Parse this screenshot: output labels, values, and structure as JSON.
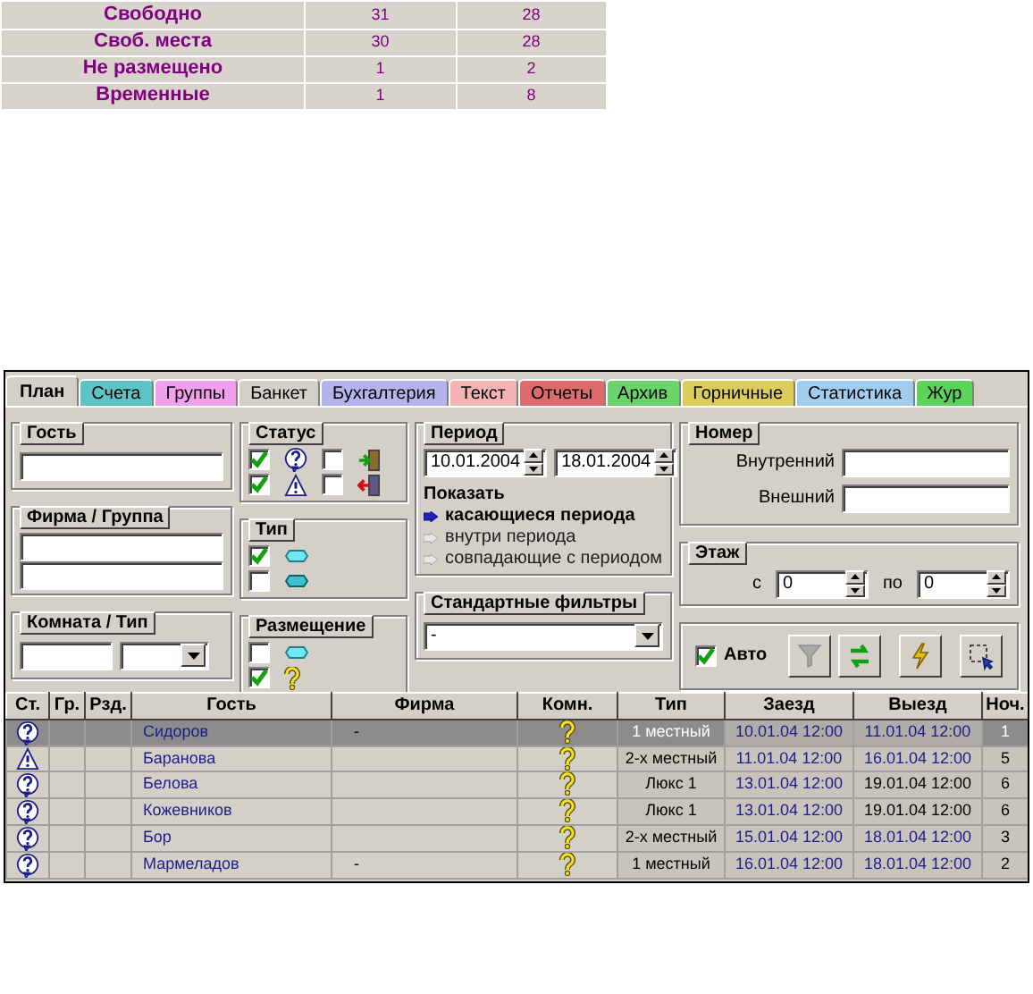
{
  "summary_table": {
    "rows": [
      {
        "label": "Свободно",
        "column_2": "31",
        "column_3": "28"
      },
      {
        "label": "Своб. места",
        "column_2": "30",
        "column_3": "28"
      },
      {
        "label": "Не размещено",
        "column_2": "1",
        "column_3": "2"
      },
      {
        "label": "Временные",
        "column_2": "1",
        "column_3": "8"
      }
    ]
  },
  "tabs": [
    {
      "label": "План",
      "color": "#d4d0c8",
      "selected": true
    },
    {
      "label": "Счета",
      "color": "#5cc4c4",
      "selected": false
    },
    {
      "label": "Группы",
      "color": "#f0a0ec",
      "selected": false
    },
    {
      "label": "Банкет",
      "color": "#d4d0c8",
      "selected": false
    },
    {
      "label": "Бухгалтерия",
      "color": "#b4b4ec",
      "selected": false
    },
    {
      "label": "Текст",
      "color": "#f4b4b4",
      "selected": false
    },
    {
      "label": "Отчеты",
      "color": "#dc6c6c",
      "selected": false
    },
    {
      "label": "Архив",
      "color": "#6cd46c",
      "selected": false
    },
    {
      "label": "Горничные",
      "color": "#dccc5c",
      "selected": false
    },
    {
      "label": "Статистика",
      "color": "#a0ccf0",
      "selected": false
    },
    {
      "label": "Жур",
      "color": "#5cd45c",
      "selected": false
    }
  ],
  "guest": {
    "title": "Гость"
  },
  "firm_group": {
    "title": "Фирма / Группа"
  },
  "room_type": {
    "title": "Комната / Тип"
  },
  "status": {
    "title": "Статус",
    "items": [
      {
        "kind": "question",
        "checked": true
      },
      {
        "kind": "door-in",
        "checked": false
      },
      {
        "kind": "warning",
        "checked": true
      },
      {
        "kind": "door-out",
        "checked": false
      }
    ]
  },
  "type": {
    "title": "Тип",
    "items": [
      {
        "kind": "bed",
        "checked": true
      },
      {
        "kind": "bed-dark",
        "checked": false
      }
    ]
  },
  "placement": {
    "title": "Размещение",
    "items": [
      {
        "kind": "bed",
        "checked": false
      },
      {
        "kind": "yellow-question",
        "checked": true
      }
    ]
  },
  "period": {
    "title": "Период",
    "from": "10.01.2004",
    "to": "18.01.2004",
    "show_label": "Показать",
    "options": [
      {
        "label": "касающиеся периода",
        "selected": true
      },
      {
        "label": "внутри периода",
        "selected": false
      },
      {
        "label": "совпадающие с периодом",
        "selected": false
      }
    ]
  },
  "number": {
    "title": "Номер",
    "fields": [
      {
        "label": "Внутренний"
      },
      {
        "label": "Внешний"
      }
    ]
  },
  "floor": {
    "title": "Этаж",
    "from_label": "с",
    "from": "0",
    "to_label": "по",
    "to": "0"
  },
  "standard_filters": {
    "title": "Стандартные фильтры",
    "value": "-"
  },
  "toolbar": {
    "auto_label": "Авто",
    "auto_checked": true,
    "buttons": [
      {
        "kind": "filter",
        "disabled": true
      },
      {
        "kind": "refresh",
        "disabled": false
      },
      {
        "kind": "flash",
        "disabled": false
      },
      {
        "kind": "select",
        "disabled": false
      }
    ]
  },
  "grid": {
    "columns": [
      "Ст.",
      "Гр.",
      "Рзд.",
      "Гость",
      "Фирма",
      "Комн.",
      "Тип",
      "Заезд",
      "Выезд",
      "Ноч."
    ],
    "rows": [
      {
        "status": {
          "kind": "question"
        },
        "guest": "Сидоров",
        "firm": "-",
        "room": {
          "kind": "yellow-question"
        },
        "type": "1 местный",
        "check_in": "10.01.04 12:00",
        "check_out": "11.01.04 12:00",
        "nights": "1",
        "selected": true,
        "color": "#1c1c8c"
      },
      {
        "status": {
          "kind": "warning"
        },
        "guest": "Баранова",
        "room": {
          "kind": "yellow-question"
        },
        "type": "2-х местный",
        "check_in": "11.01.04 12:00",
        "check_out": "16.01.04 12:00",
        "nights": "5",
        "selected": false,
        "color": "#1c1c8c"
      },
      {
        "status": {
          "kind": "question"
        },
        "guest": "Белова",
        "room": {
          "kind": "yellow-question"
        },
        "type": "Люкс 1",
        "check_in": "13.01.04 12:00",
        "check_out": "19.01.04 12:00",
        "nights": "6",
        "selected": false,
        "color": "#000000"
      },
      {
        "status": {
          "kind": "question"
        },
        "guest": "Кожевников",
        "room": {
          "kind": "yellow-question"
        },
        "type": "Люкс 1",
        "check_in": "13.01.04 12:00",
        "check_out": "19.01.04 12:00",
        "nights": "6",
        "selected": false,
        "color": "#000000"
      },
      {
        "status": {
          "kind": "question"
        },
        "guest": "Бор",
        "room": {
          "kind": "yellow-question"
        },
        "type": "2-х местный",
        "check_in": "15.01.04 12:00",
        "check_out": "18.01.04 12:00",
        "nights": "3",
        "selected": false,
        "color": "#1c1c8c"
      },
      {
        "status": {
          "kind": "question"
        },
        "guest": "Мармеладов",
        "firm": "-",
        "room": {
          "kind": "yellow-question"
        },
        "type": "1 местный",
        "check_in": "16.01.04 12:00",
        "check_out": "18.01.04 12:00",
        "nights": "2",
        "selected": false,
        "color": "#1c1c8c"
      }
    ]
  }
}
